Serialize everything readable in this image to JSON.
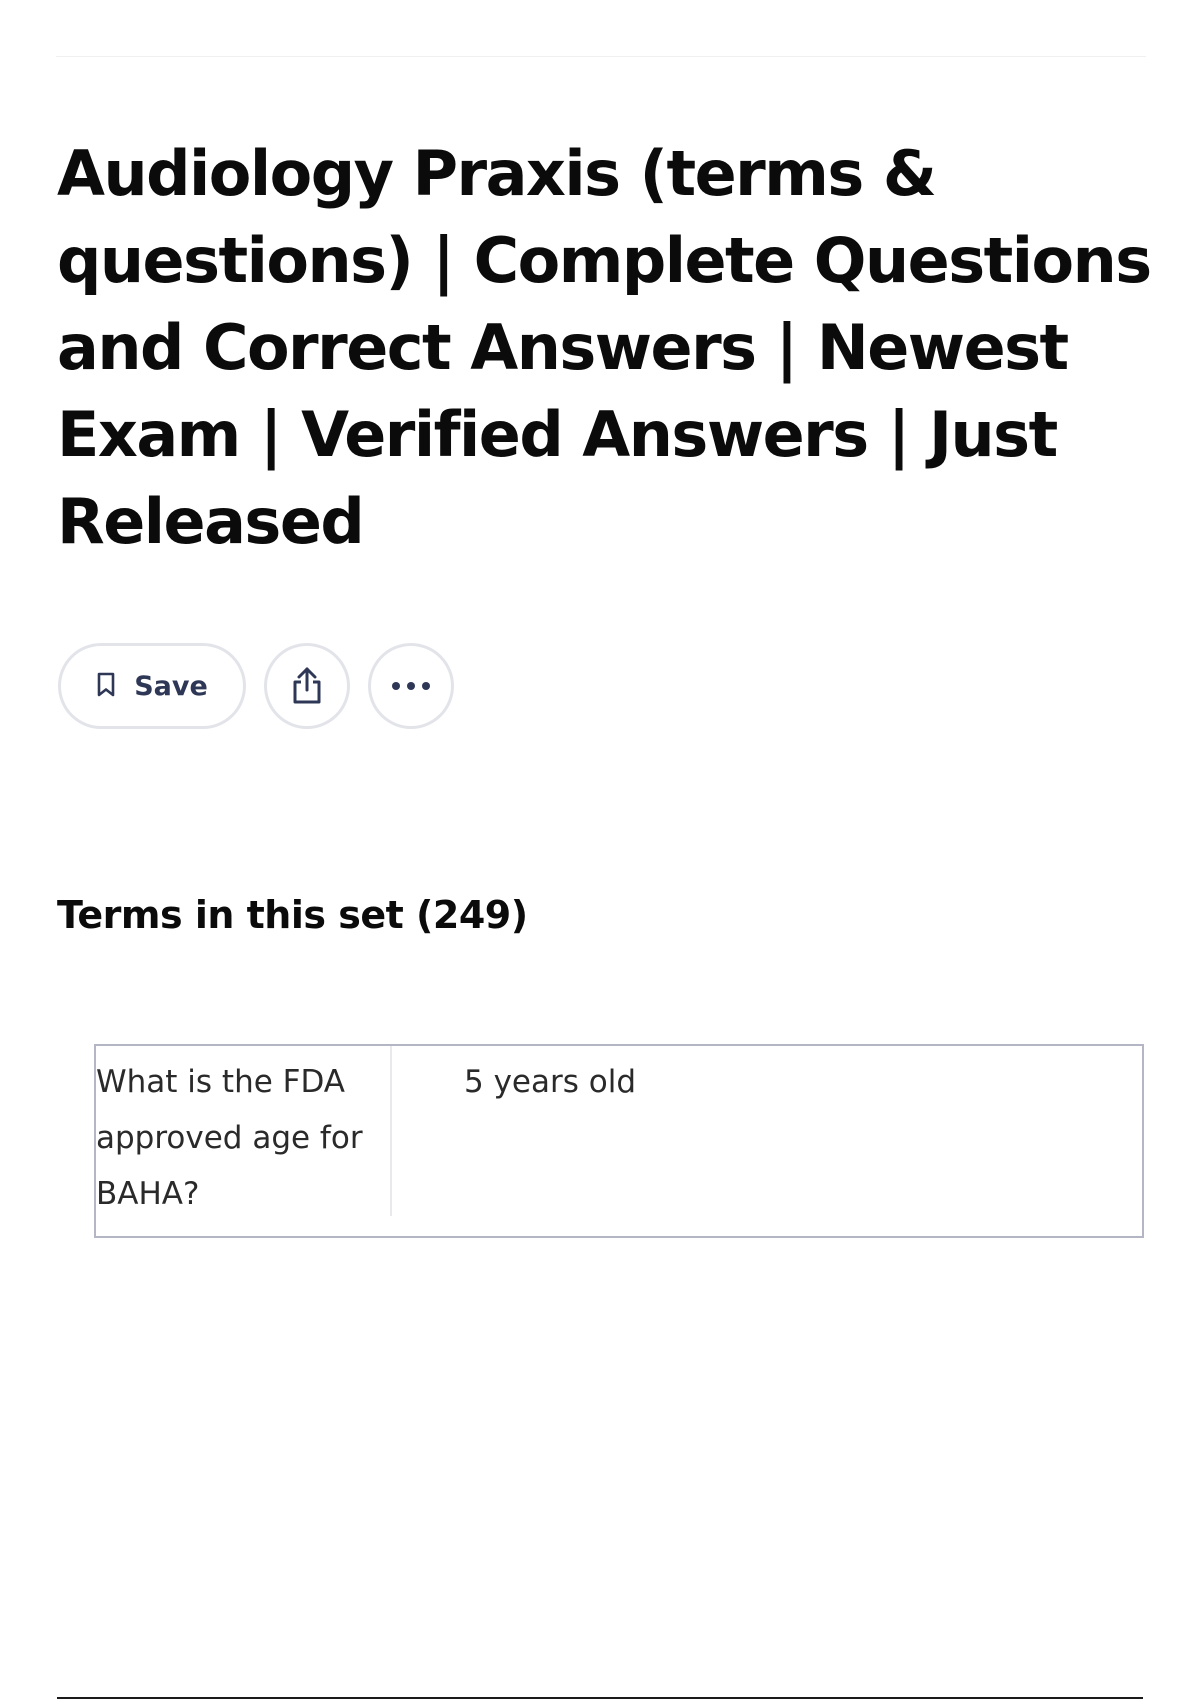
{
  "page": {
    "title": "Audiology Praxis (terms & questions) | Complete Questions and Correct Answers | Newest Exam | Verified Answers | Just Released"
  },
  "actions": {
    "save_label": "Save",
    "save_icon": "bookmark-icon",
    "share_icon": "share-icon",
    "more_icon": "more-dots-icon"
  },
  "terms_section": {
    "heading": "Terms in this set (249)"
  },
  "cards": [
    {
      "term": "What is the FDA approved age for BAHA?",
      "definition": "5 years old"
    }
  ],
  "colors": {
    "text": "#0b0b0b",
    "button_border": "#e3e4ea",
    "icon": "#586380",
    "card_border": "#b4b6c6"
  }
}
